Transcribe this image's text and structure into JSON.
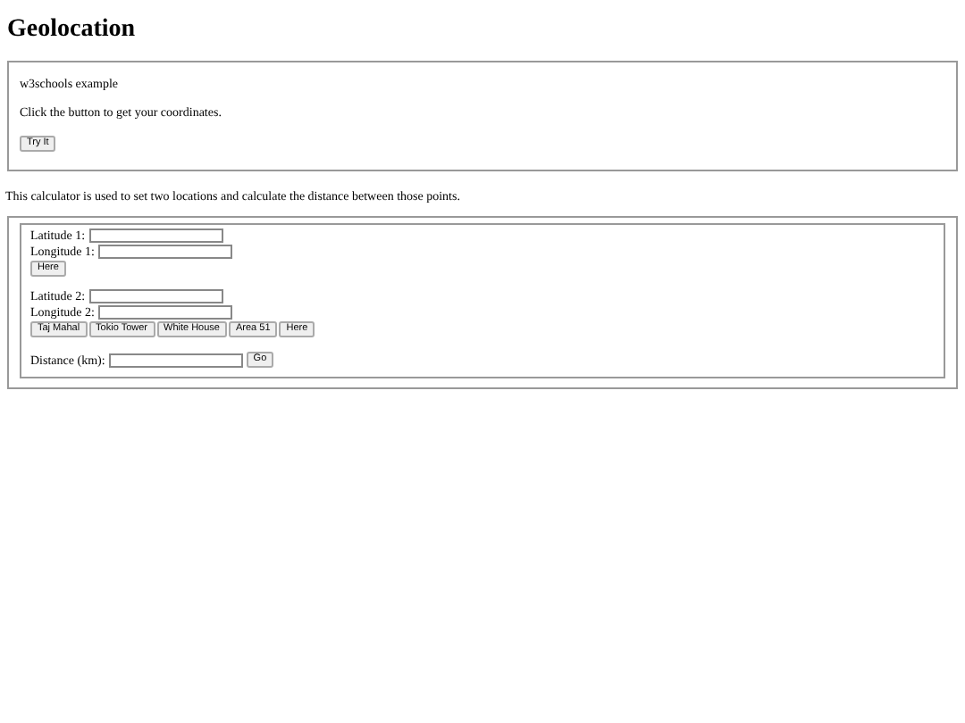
{
  "heading": "Geolocation",
  "example": {
    "caption": "w3schools example",
    "instruction": "Click the button to get your coordinates.",
    "button": "Try It"
  },
  "intro": "This calculator is used to set two locations and calculate the distance between those points.",
  "point1": {
    "fields": [
      {
        "label": "Latitude 1:"
      },
      {
        "label": "Longitude 1:"
      }
    ],
    "buttons": [
      "Here"
    ]
  },
  "point2": {
    "fields": [
      {
        "label": "Latitude 2:"
      },
      {
        "label": "Longitude 2:"
      }
    ],
    "buttons": [
      "Taj Mahal",
      "Tokio Tower",
      "White House",
      "Area 51",
      "Here"
    ]
  },
  "distance": {
    "label": "Distance (km):",
    "button": "Go"
  }
}
